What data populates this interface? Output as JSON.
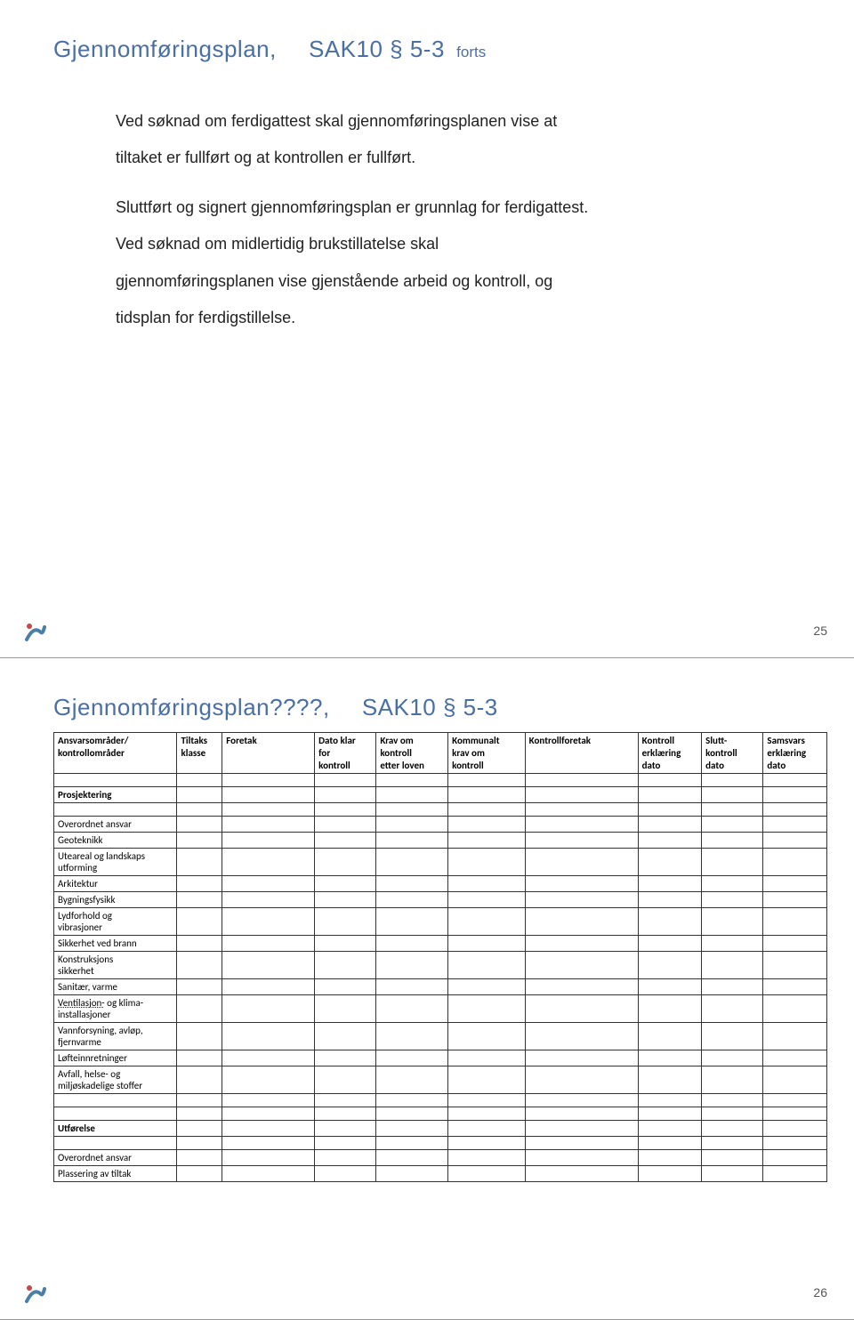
{
  "slide1": {
    "title_main": "Gjennomføringsplan,",
    "title_ref": "SAK10 § 5-3",
    "title_suffix": "forts",
    "body_line1": "Ved søknad om ferdigattest skal gjennomføringsplanen vise at",
    "body_line2": "tiltaket er fullført og at kontrollen er fullført.",
    "body_line3": "Sluttført og signert gjennomføringsplan er grunnlag for ferdigattest.",
    "body_line4": "Ved søknad om midlertidig brukstillatelse skal",
    "body_line5": "gjennomføringsplanen vise gjenstående arbeid og kontroll, og",
    "body_line6": "tidsplan for ferdigstillelse.",
    "page_number": "25"
  },
  "slide2": {
    "title_main": "Gjennomføringsplan????,",
    "title_ref": "SAK10 § 5-3",
    "page_number": "26",
    "table": {
      "headers": [
        "Ansvarsområder/\nkontrollområder",
        "Tiltaks\nklasse",
        "Foretak",
        "Dato klar\nfor\nkontroll",
        "Krav om\nkontroll\netter loven",
        "Kommunalt\nkrav om\nkontroll",
        "Kontrollforetak",
        "Kontroll\nerklæring\ndato",
        "Slutt-\nkontroll\ndato",
        "Samsvars\nerklæring\ndato"
      ],
      "section1": "Prosjektering",
      "rows1": [
        "Overordnet ansvar",
        "Geoteknikk",
        "Uteareal og landskaps\nutforming",
        "Arkitektur",
        "Bygningsfysikk",
        "Lydforhold og\nvibrasjoner",
        "Sikkerhet ved brann",
        "Konstruksjons\nsikkerhet",
        "Sanitær, varme",
        "Ventilasjon- og klima-\ninstallasjoner",
        "Vannforsyning, avløp,\nfjernvarme",
        "Løfteinnretninger",
        "Avfall, helse- og\nmiljøskadelige stoffer"
      ],
      "section2": "Utførelse",
      "rows2": [
        "Overordnet ansvar",
        "Plassering av tiltak"
      ]
    }
  }
}
